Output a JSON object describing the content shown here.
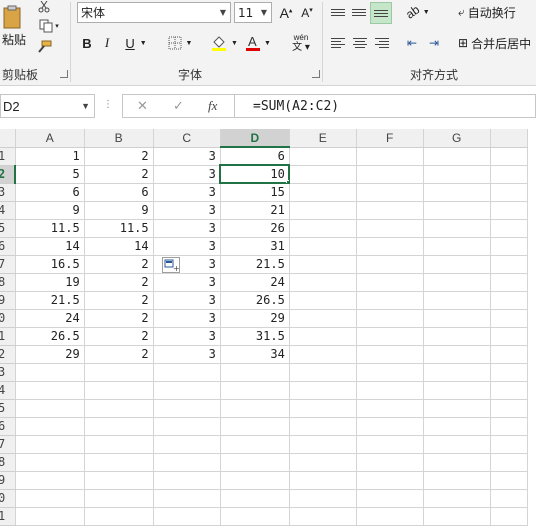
{
  "ribbon": {
    "clipboard": {
      "paste_label": "粘贴",
      "group_label": "剪贴板"
    },
    "font": {
      "font_name": "宋体",
      "font_size": "11",
      "bold": "B",
      "italic": "I",
      "underline": "U",
      "phonetic": "wén",
      "group_label": "字体"
    },
    "alignment": {
      "wrap_text": "自动换行",
      "merge_center": "合并后居中",
      "group_label": "对齐方式"
    }
  },
  "formula_bar": {
    "name_box": "D2",
    "cancel": "✕",
    "enter": "✓",
    "fx": "fx",
    "formula": "=SUM(A2:C2)"
  },
  "grid": {
    "columns": [
      "A",
      "B",
      "C",
      "D",
      "E",
      "F",
      "G"
    ],
    "row_labels": [
      "1",
      "2",
      "3",
      "4",
      "5",
      "6",
      "7",
      "8",
      "9",
      "0",
      "1",
      "2",
      "3",
      "4",
      "5",
      "6",
      "7",
      "8",
      "9",
      "0",
      "1"
    ],
    "rows": [
      [
        "1",
        "2",
        "3",
        "6"
      ],
      [
        "5",
        "2",
        "3",
        "10"
      ],
      [
        "6",
        "6",
        "3",
        "15"
      ],
      [
        "9",
        "9",
        "3",
        "21"
      ],
      [
        "11.5",
        "11.5",
        "3",
        "26"
      ],
      [
        "14",
        "14",
        "3",
        "31"
      ],
      [
        "16.5",
        "2",
        "3",
        "21.5"
      ],
      [
        "19",
        "2",
        "3",
        "24"
      ],
      [
        "21.5",
        "2",
        "3",
        "26.5"
      ],
      [
        "24",
        "2",
        "3",
        "29"
      ],
      [
        "26.5",
        "2",
        "3",
        "31.5"
      ],
      [
        "29",
        "2",
        "3",
        "34"
      ]
    ],
    "selected_column": "D",
    "selected_row_index": 1
  },
  "colors": {
    "accent": "#217346",
    "header_bg": "#f0f0f0",
    "ribbon_bg": "#f3f3f3"
  }
}
